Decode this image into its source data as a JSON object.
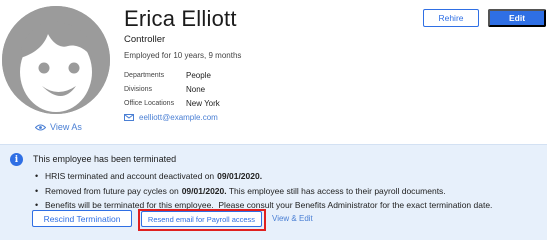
{
  "profile": {
    "name": "Erica Elliott",
    "title": "Controller",
    "tenure": "Employed for 10 years, 9 months",
    "details": [
      {
        "label": "Departments",
        "value": "People"
      },
      {
        "label": "Divisions",
        "value": "None"
      },
      {
        "label": "Office Locations",
        "value": "New York"
      }
    ],
    "email": "eelliott@example.com",
    "view_as_label": "View As"
  },
  "actions": {
    "rehire_label": "Rehire",
    "edit_label": "Edit"
  },
  "banner": {
    "title": "This employee has been terminated",
    "bullets": [
      {
        "text": "HRIS terminated and account deactivated on",
        "bold": "09/01/2020.",
        "after": ""
      },
      {
        "text": "Removed from future pay cycles on",
        "bold": "09/01/2020.",
        "after": " This employee still has access to their payroll documents."
      },
      {
        "text": "Benefits will be terminated for this employee.  Please consult your Benefits Administrator for the exact termination date.",
        "bold": "",
        "after": ""
      }
    ],
    "rescind_label": "Rescind Termination",
    "resend_label": "Resend email for Payroll access",
    "view_edit_label": "View & Edit"
  },
  "colors": {
    "accent": "#2f6fe4",
    "banner_bg": "#e7f0fb",
    "highlight": "#e02020",
    "avatar_bg": "#9b9b9b"
  },
  "icons": [
    "avatar-placeholder",
    "eye-icon",
    "mail-icon",
    "info-icon"
  ]
}
